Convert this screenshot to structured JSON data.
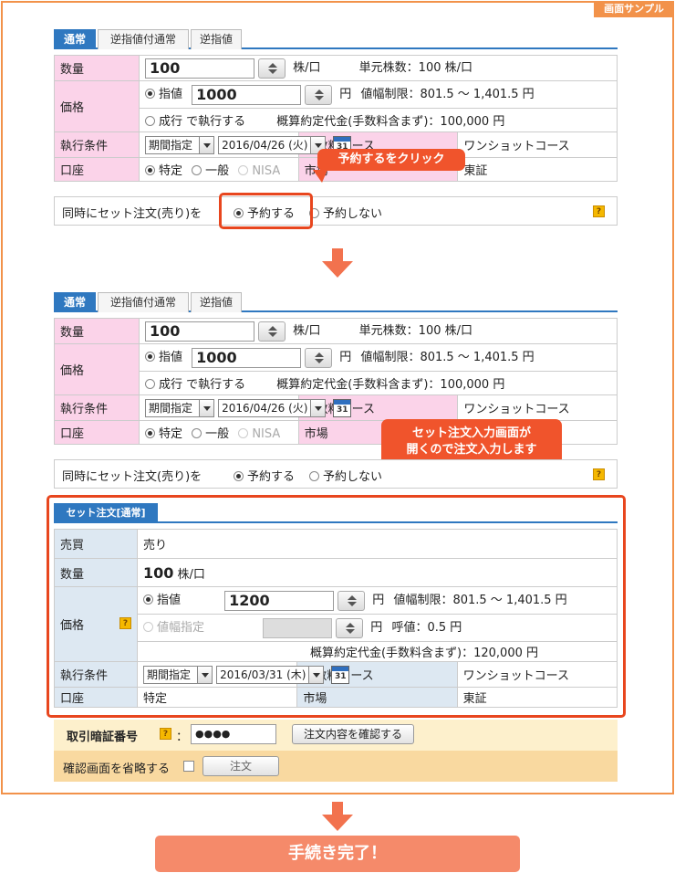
{
  "sample_badge": "画面サンプル",
  "tabs": [
    "通常",
    "逆指値付通常",
    "逆指値"
  ],
  "form": {
    "quantity_label": "数量",
    "quantity_value": "100",
    "quantity_unit": "株/口",
    "unit_shares": "単元株数：100 株/口",
    "price_label": "価格",
    "limit_label": "指値",
    "limit_value": "1000",
    "yen": "円",
    "price_range": "値幅制限：801.5 〜 1,401.5 円",
    "market_label": "成行 で執行する",
    "estimate": "概算約定代金(手数料含まず)：100,000 円",
    "condition_label": "執行条件",
    "period_select": "期間指定",
    "date_select": "2016/04/26 (火)",
    "fee_label": "手数料コース",
    "fee_value": "ワンショットコース",
    "account_label": "口座",
    "acct_tokutei": "特定",
    "acct_ippan": "一般",
    "acct_nisa": "NISA",
    "market_place_label": "市場",
    "market_place_value": "東証"
  },
  "set_order_row": {
    "label": "同時にセット注文(売り)を",
    "reserve": "予約する",
    "no_reserve": "予約しない",
    "help": "?"
  },
  "callout1": "予約するをクリック",
  "callout2_line1": "セット注文入力画面が",
  "callout2_line2": "開くので注文入力します",
  "set_panel": {
    "tab": "セット注文[通常]",
    "side_label": "売買",
    "side_value": "売り",
    "quantity_label": "数量",
    "quantity_value": "100",
    "quantity_unit": "株/口",
    "price_label": "価格",
    "limit_label": "指値",
    "limit_value": "1200",
    "yen": "円",
    "price_range": "値幅制限：801.5 〜 1,401.5 円",
    "range_label": "値幅指定",
    "tick": "呼値：0.5 円",
    "estimate": "概算約定代金(手数料含まず)：120,000 円",
    "condition_label": "執行条件",
    "period_select": "期間指定",
    "date_select": "2016/03/31 (木)",
    "fee_label": "手数料コース",
    "fee_value": "ワンショットコース",
    "account_label": "口座",
    "account_value": "特定",
    "market_place_label": "市場",
    "market_place_value": "東証"
  },
  "pin": {
    "label": "取引暗証番号",
    "colon": "：",
    "value": "●●●●",
    "confirm_button": "注文内容を確認する",
    "skip_label": "確認画面を省略する",
    "order_button": "注文"
  },
  "complete": "手続き完了！",
  "calendar_day": "31"
}
